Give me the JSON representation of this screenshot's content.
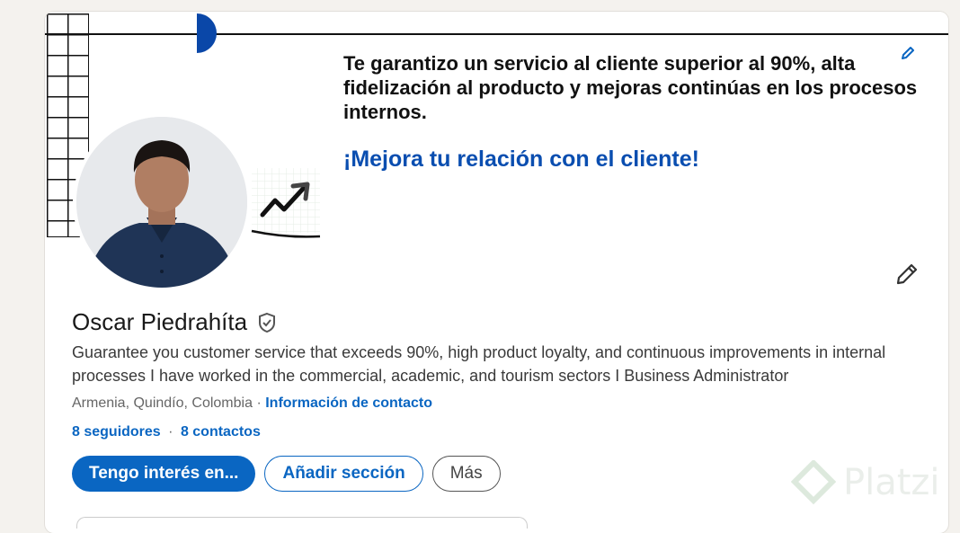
{
  "banner": {
    "headline": "Te garantizo un servicio al cliente superior al 90%, alta fidelización al producto y mejoras continúas en los procesos internos.",
    "cta": "¡Mejora tu relación con el cliente!",
    "accent_color": "#0a47a8"
  },
  "profile": {
    "name": "Oscar Piedrahíta",
    "headline": "Guarantee you customer service that exceeds 90%, high product loyalty, and continuous improvements in internal processes I have worked in the commercial, academic, and tourism sectors I Business Administrator",
    "location": "Armenia, Quindío, Colombia",
    "location_separator": "·",
    "contact_link": "Información de contacto",
    "followers": "8 seguidores",
    "connections_separator": "·",
    "connections": "8 contactos"
  },
  "actions": {
    "primary": "Tengo interés en...",
    "add_section": "Añadir sección",
    "more": "Más"
  },
  "watermark": "Platzi",
  "colors": {
    "link": "#0a66c2",
    "background": "#f4f2ee"
  },
  "icons": [
    "edit-banner-icon",
    "chart-trend-icon",
    "edit-profile-icon",
    "verified-icon",
    "platzi-logo-icon"
  ]
}
